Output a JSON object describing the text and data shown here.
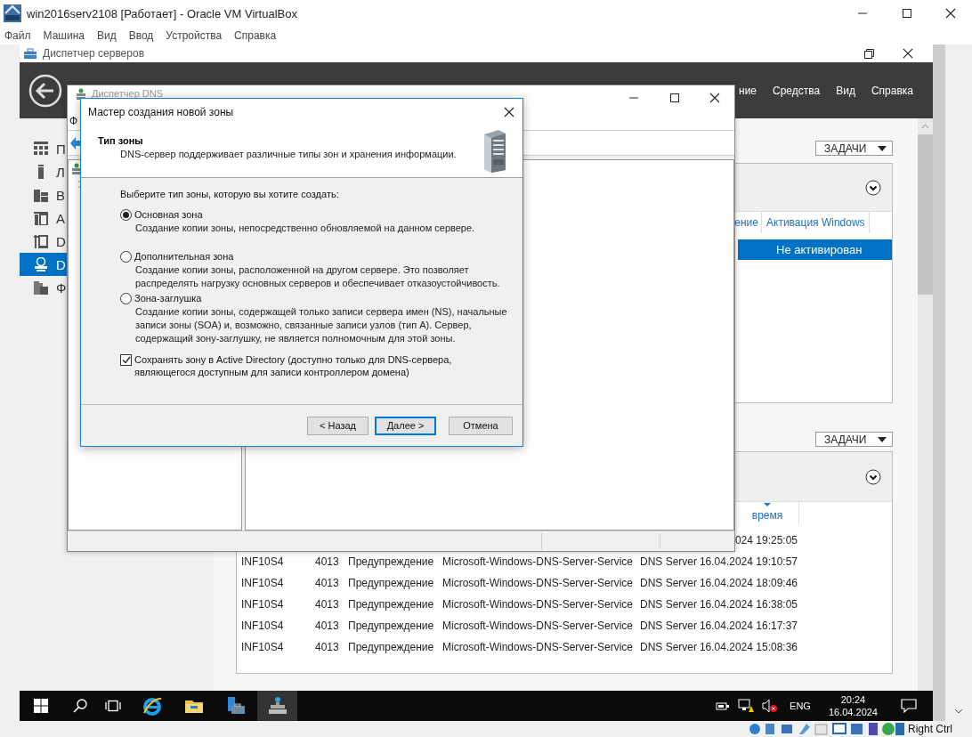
{
  "vbox": {
    "title": "win2016serv2108 [Работает] - Oracle VM VirtualBox",
    "menu": [
      "Файл",
      "Машина",
      "Вид",
      "Ввод",
      "Устройства",
      "Справка"
    ]
  },
  "server_manager": {
    "title": "Диспетчер серверов",
    "menu": [
      "ние",
      "Средства",
      "Вид",
      "Справка"
    ],
    "nav": [
      {
        "label": "П",
        "selected": false
      },
      {
        "label": "Л",
        "selected": false
      },
      {
        "label": "В",
        "selected": false
      },
      {
        "label": "A",
        "selected": false
      },
      {
        "label": "D",
        "selected": false
      },
      {
        "label": "D",
        "selected": true
      },
      {
        "label": "Ф",
        "selected": false
      }
    ],
    "sections": [
      {
        "kind": "servers",
        "tasks": "ЗАДАЧИ",
        "columns": [
          "ение",
          "Активация Windows"
        ],
        "rows": [
          {
            "cells": [
              "",
              "Не активирован"
            ],
            "selected": true
          }
        ]
      },
      {
        "kind": "events",
        "tasks": "ЗАДАЧИ",
        "columns": [
          "время"
        ],
        "rows": [
          {
            "datetime": "024 19:25:05"
          },
          {
            "computer": "INF10S4",
            "id": "4013",
            "level": "Предупреждение",
            "source": "Microsoft-Windows-DNS-Server-Service",
            "log": "DNS Server",
            "datetime": "16.04.2024 19:10:57"
          },
          {
            "computer": "INF10S4",
            "id": "4013",
            "level": "Предупреждение",
            "source": "Microsoft-Windows-DNS-Server-Service",
            "log": "DNS Server",
            "datetime": "16.04.2024 18:09:46"
          },
          {
            "computer": "INF10S4",
            "id": "4013",
            "level": "Предупреждение",
            "source": "Microsoft-Windows-DNS-Server-Service",
            "log": "DNS Server",
            "datetime": "16.04.2024 16:38:05"
          },
          {
            "computer": "INF10S4",
            "id": "4013",
            "level": "Предупреждение",
            "source": "Microsoft-Windows-DNS-Server-Service",
            "log": "DNS Server",
            "datetime": "16.04.2024 16:17:37"
          },
          {
            "computer": "INF10S4",
            "id": "4013",
            "level": "Предупреждение",
            "source": "Microsoft-Windows-DNS-Server-Service",
            "log": "DNS Server",
            "datetime": "16.04.2024 15:08:36"
          }
        ]
      }
    ]
  },
  "dns_manager": {
    "title": "Диспетчер DNS",
    "menu": [
      "Ф"
    ]
  },
  "wizard": {
    "title": "Мастер создания новой зоны",
    "heading": "Тип зоны",
    "subheading": "DNS-сервер поддерживает различные типы зон и хранения информации.",
    "prompt": "Выберите тип зоны, которую вы хотите создать:",
    "options": [
      {
        "label": "Основная зона",
        "description": "Создание копии зоны, непосредственно обновляемой на данном сервере.",
        "selected": true
      },
      {
        "label": "Дополнительная зона",
        "description": "Создание копии зоны, расположенной на другом сервере. Это позволяет распределять нагрузку основных серверов и обеспечивает отказоустойчивость.",
        "selected": false
      },
      {
        "label": "Зона-заглушка",
        "description": "Создание копии зоны, содержащей только записи сервера имен (NS), начальные записи зоны (SOA) и, возможно, связанные записи узлов (тип А). Сервер, содержащий зону-заглушку, не является полномочным для этой зоны.",
        "selected": false
      }
    ],
    "store_in_ad": {
      "label": "Сохранять зону в Active Directory (доступно только для DNS-сервера, являющегося доступным для записи контроллером домена)",
      "checked": true
    },
    "buttons": [
      {
        "label": "< Назад",
        "focused": false
      },
      {
        "label": "Далее >",
        "focused": true
      },
      {
        "label": "Отмена",
        "focused": false
      }
    ]
  },
  "taskbar": {
    "apps": [
      {
        "kind": "ie",
        "active": false
      },
      {
        "kind": "explorer",
        "active": false
      },
      {
        "kind": "server-manager",
        "active": false
      },
      {
        "kind": "dns",
        "active": true
      }
    ],
    "language": "ENG",
    "time": "20:24",
    "date": "16.04.2024"
  },
  "status_bar": {
    "host_key": "Right Ctrl"
  }
}
